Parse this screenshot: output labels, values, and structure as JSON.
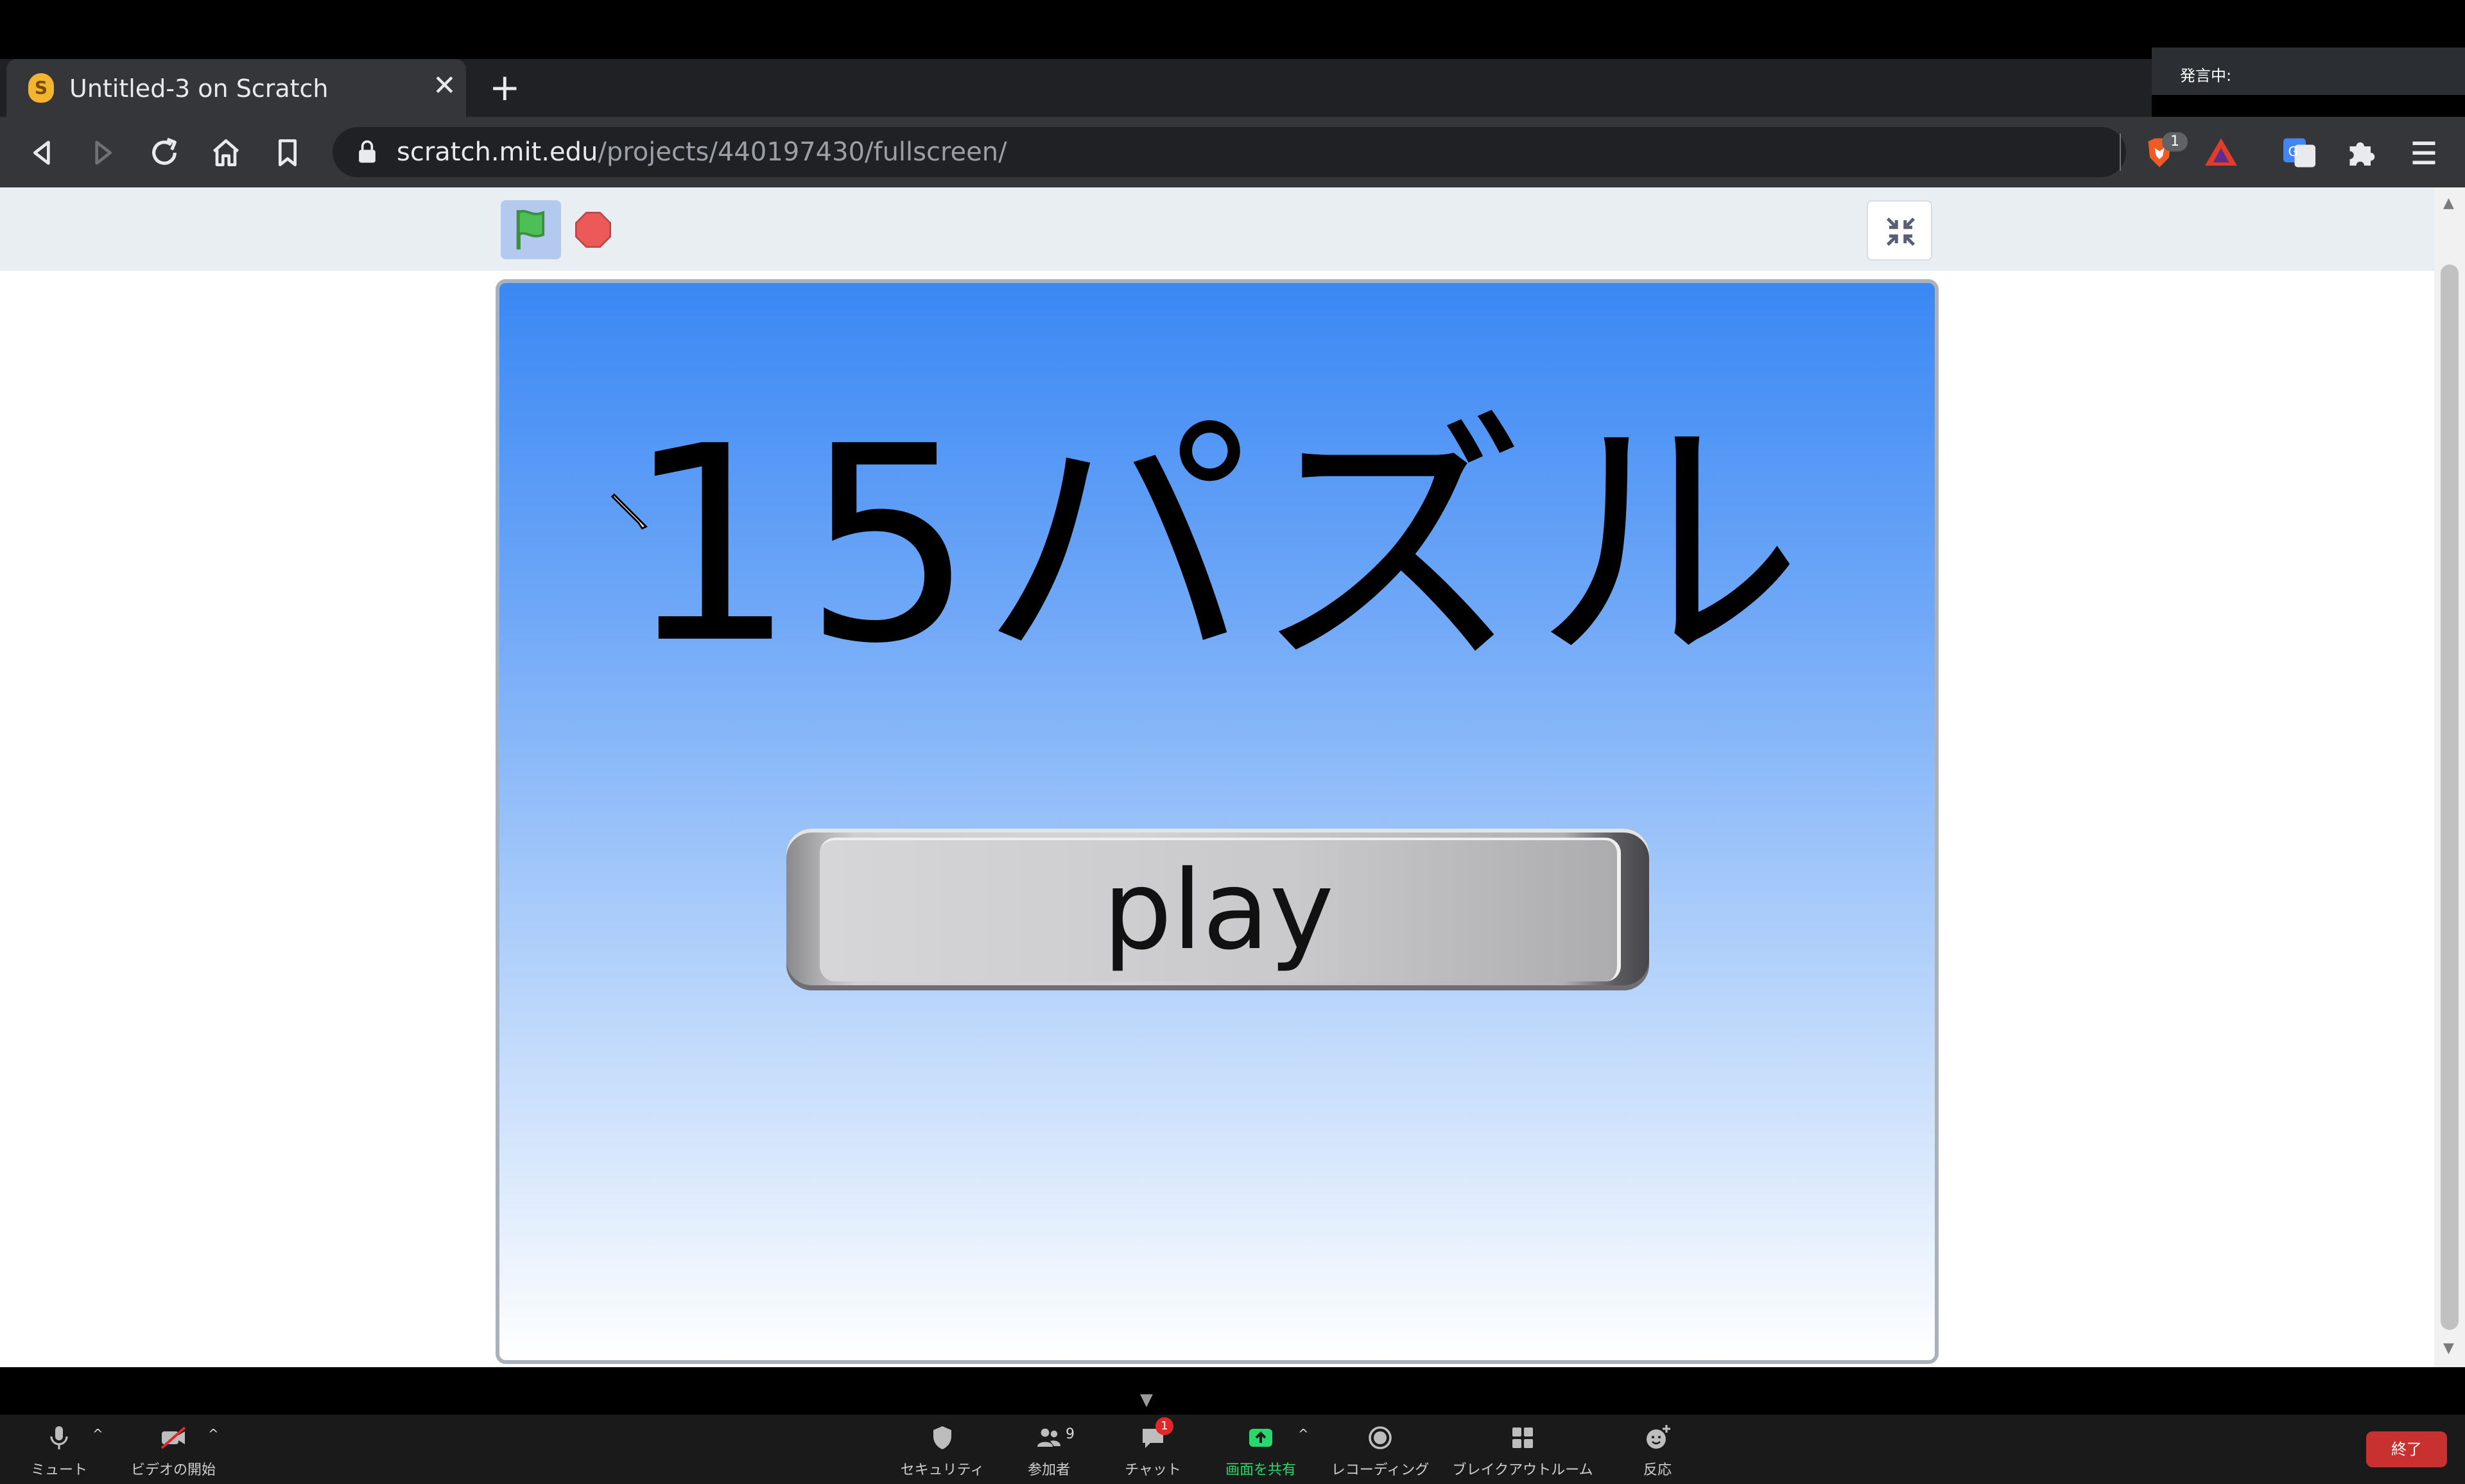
{
  "zoom_status": {
    "speaking": "発言中:"
  },
  "browser": {
    "tab": {
      "title": "Untitled-3 on Scratch"
    },
    "url": {
      "host": "scratch.mit.edu",
      "path": "/projects/440197430/fullscreen/"
    },
    "extensions": {
      "brave_shields_count": "1"
    }
  },
  "stage": {
    "title": "15パズル",
    "play_label": "play"
  },
  "zoom": {
    "mute": "ミュート",
    "video": "ビデオの開始",
    "security": "セキュリティ",
    "participants": "参加者",
    "participants_count": "9",
    "chat": "チャット",
    "chat_badge": "1",
    "share": "画面を共有",
    "recording": "レコーディング",
    "breakout": "ブレイクアウトルーム",
    "reactions": "反応",
    "end": "終了"
  },
  "colors": {
    "stage_top": "#3a88f4",
    "stage_bottom": "#ffffff",
    "flag_green": "#4cbf56",
    "stop_red": "#ec5959",
    "zoom_share_green": "#27d86f",
    "zoom_end_red": "#c93030"
  }
}
